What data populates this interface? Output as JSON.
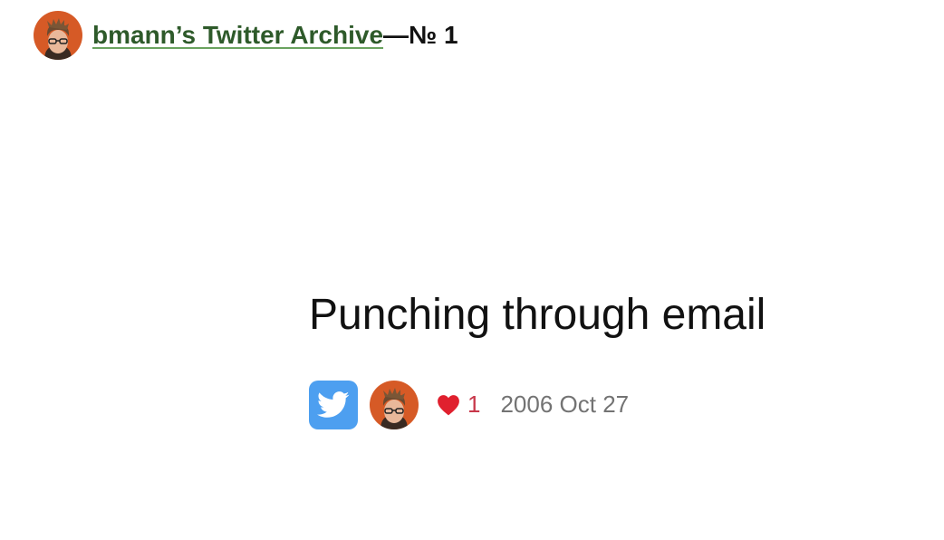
{
  "header": {
    "archive_link": "bmann’s Twitter Archive",
    "suffix": "—№ 1",
    "avatar_icon": "user-avatar"
  },
  "tweet": {
    "text": "Punching through email",
    "likes_count": "1",
    "date": "2006 Oct 27",
    "twitter_icon": "twitter-bird-icon",
    "heart_icon": "heart-icon"
  },
  "colors": {
    "link": "#2e5a2a",
    "twitter_blue": "#4d9ff0",
    "likes": "#c8374a",
    "date": "#737373",
    "avatar_bg": "#d65a26"
  }
}
